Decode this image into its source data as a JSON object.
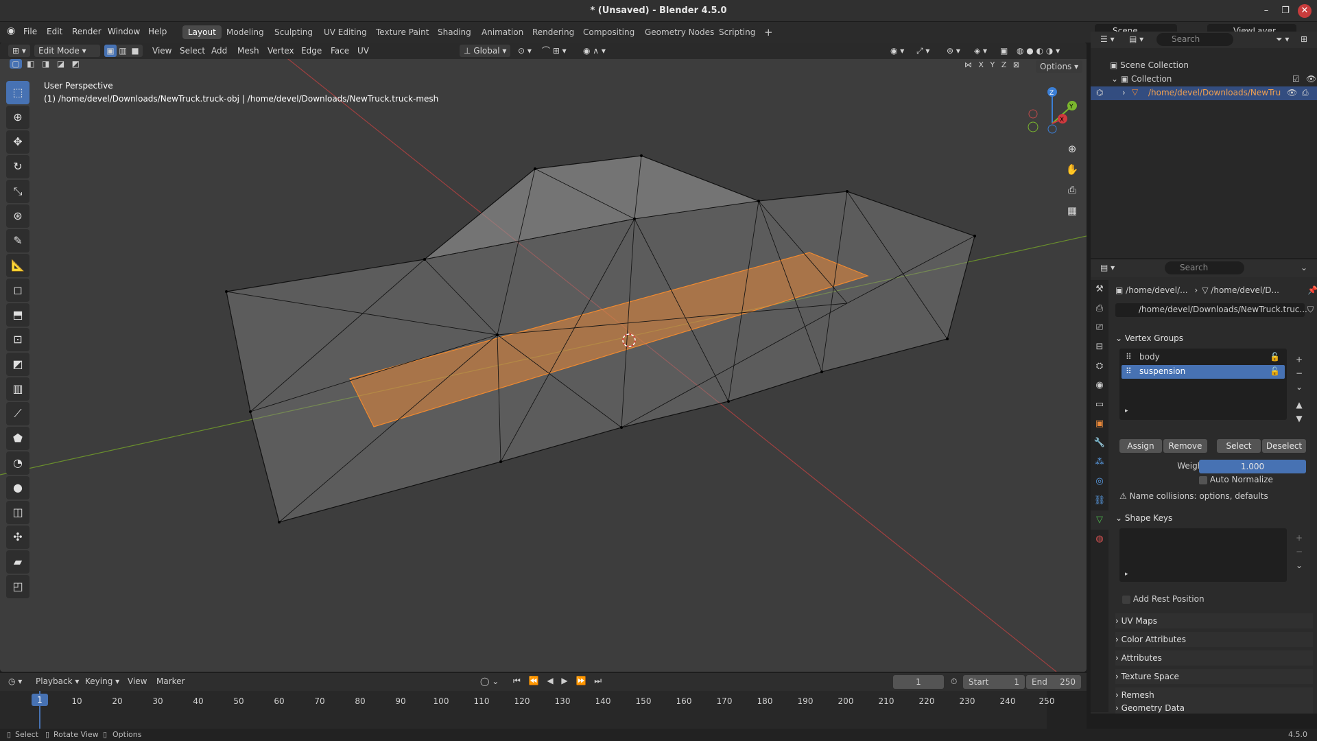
{
  "window": {
    "title": "* (Unsaved) - Blender 4.5.0",
    "min": "–",
    "max": "❐",
    "close": "✕"
  },
  "menu": {
    "file": "File",
    "edit": "Edit",
    "render": "Render",
    "window": "Window",
    "help": "Help"
  },
  "workspaces": [
    "Layout",
    "Modeling",
    "Sculpting",
    "UV Editing",
    "Texture Paint",
    "Shading",
    "Animation",
    "Rendering",
    "Compositing",
    "Geometry Nodes",
    "Scripting"
  ],
  "scene": {
    "name": "Scene",
    "view_layer": "ViewLayer"
  },
  "viewport": {
    "mode": "Edit Mode",
    "menus": [
      "View",
      "Select",
      "Add",
      "Mesh",
      "Vertex",
      "Edge",
      "Face",
      "UV"
    ],
    "orientation": "Global",
    "options": "Options",
    "perspective": "User Perspective",
    "object_info": "(1) /home/devel/Downloads/NewTruck.truck-obj | /home/devel/Downloads/NewTruck.truck-mesh",
    "axes": [
      "X",
      "Y",
      "Z"
    ],
    "gizmo": {
      "x": "X",
      "y": "Y",
      "z": "Z"
    }
  },
  "outliner": {
    "search": "Search",
    "scene_collection": "Scene Collection",
    "collection": "Collection",
    "object": "/home/devel/Downloads/NewTru"
  },
  "properties": {
    "search": "Search",
    "crumb_obj": "/home/devel/...",
    "crumb_mesh": "/home/devel/D...",
    "mesh_name": "/home/devel/Downloads/NewTruck.truc...",
    "vertex_groups": {
      "title": "Vertex Groups",
      "items": [
        {
          "name": "body"
        },
        {
          "name": "suspension"
        }
      ],
      "assign": "Assign",
      "remove": "Remove",
      "select": "Select",
      "deselect": "Deselect",
      "weight_label": "Weight",
      "weight": "1.000",
      "auto_normalize": "Auto Normalize",
      "warning": "Name collisions: options, defaults"
    },
    "shape_keys": {
      "title": "Shape Keys",
      "add_rest": "Add Rest Position"
    },
    "collapsed": [
      "UV Maps",
      "Color Attributes",
      "Attributes",
      "Texture Space",
      "Remesh",
      "Geometry Data"
    ]
  },
  "timeline": {
    "playback": "Playback",
    "keying": "Keying",
    "view": "View",
    "marker": "Marker",
    "current": "1",
    "start_label": "Start",
    "start": "1",
    "end_label": "End",
    "end": "250",
    "frame_marker": "1",
    "ticks": [
      "10",
      "20",
      "30",
      "40",
      "50",
      "60",
      "70",
      "80",
      "90",
      "100",
      "110",
      "120",
      "130",
      "140",
      "150",
      "160",
      "170",
      "180",
      "190",
      "200",
      "210",
      "220",
      "230",
      "240",
      "250"
    ]
  },
  "status": {
    "select": "Select",
    "rotate": "Rotate View",
    "options": "Options",
    "version": "4.5.0"
  },
  "colors": {
    "accent": "#4772b3",
    "selection": "#e8883a",
    "bg": "#3d3d3d"
  }
}
